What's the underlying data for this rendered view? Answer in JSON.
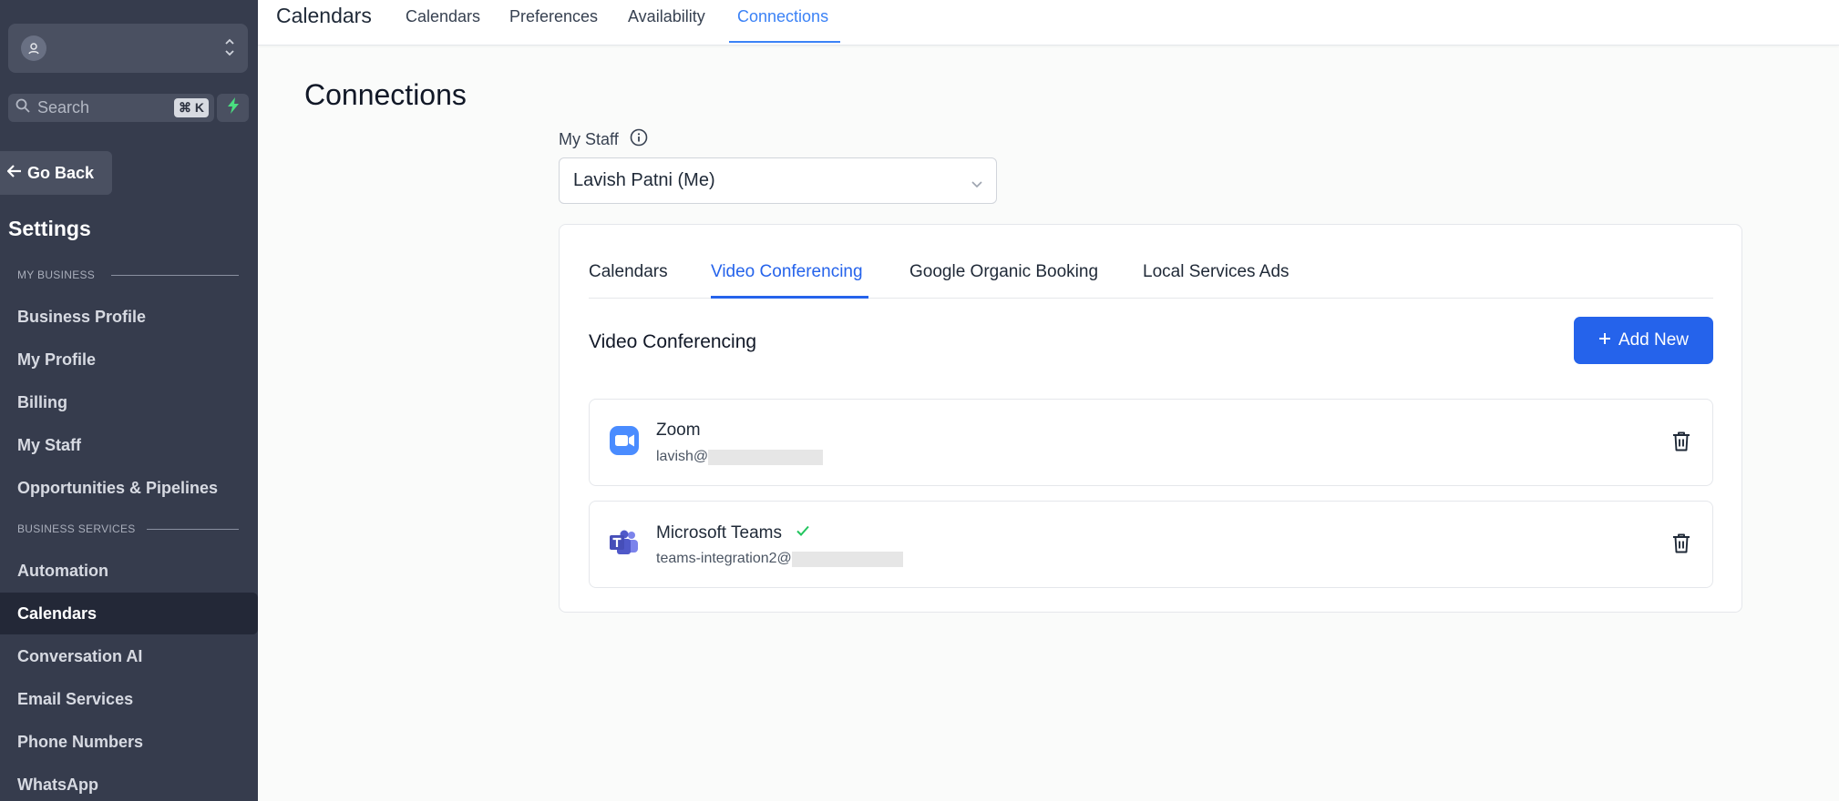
{
  "sidebar": {
    "search_placeholder": "Search",
    "search_shortcut": "⌘ K",
    "go_back": "Go Back",
    "settings_title": "Settings",
    "section_my_business": "MY BUSINESS",
    "section_business_services": "BUSINESS SERVICES",
    "items": [
      {
        "label": "Business Profile"
      },
      {
        "label": "My Profile"
      },
      {
        "label": "Billing"
      },
      {
        "label": "My Staff"
      },
      {
        "label": "Opportunities & Pipelines"
      },
      {
        "label": "Automation"
      },
      {
        "label": "Calendars"
      },
      {
        "label": "Conversation AI"
      },
      {
        "label": "Email Services"
      },
      {
        "label": "Phone Numbers"
      },
      {
        "label": "WhatsApp"
      }
    ],
    "active_item": "Calendars"
  },
  "topbar": {
    "title": "Calendars",
    "tabs": [
      {
        "label": "Calendars"
      },
      {
        "label": "Preferences"
      },
      {
        "label": "Availability"
      },
      {
        "label": "Connections"
      }
    ],
    "active_tab": "Connections"
  },
  "main": {
    "page_title": "Connections",
    "staff_label": "My Staff",
    "staff_value": "Lavish Patni (Me)",
    "card_tabs": [
      {
        "label": "Calendars"
      },
      {
        "label": "Video Conferencing"
      },
      {
        "label": "Google Organic Booking"
      },
      {
        "label": "Local Services Ads"
      }
    ],
    "active_card_tab": "Video Conferencing",
    "section_heading": "Video Conferencing",
    "add_button": "Add New",
    "connections": [
      {
        "name": "Zoom",
        "email": "lavish@",
        "icon": "zoom-icon",
        "verified": false
      },
      {
        "name": "Microsoft Teams",
        "email": "teams-integration2@",
        "icon": "microsoft-teams-icon",
        "verified": true
      }
    ]
  },
  "colors": {
    "sidebar_bg": "#363c4d",
    "accent": "#2563eb",
    "zoom": "#4a8cff",
    "teams": "#5059c9",
    "success": "#22c55e"
  }
}
